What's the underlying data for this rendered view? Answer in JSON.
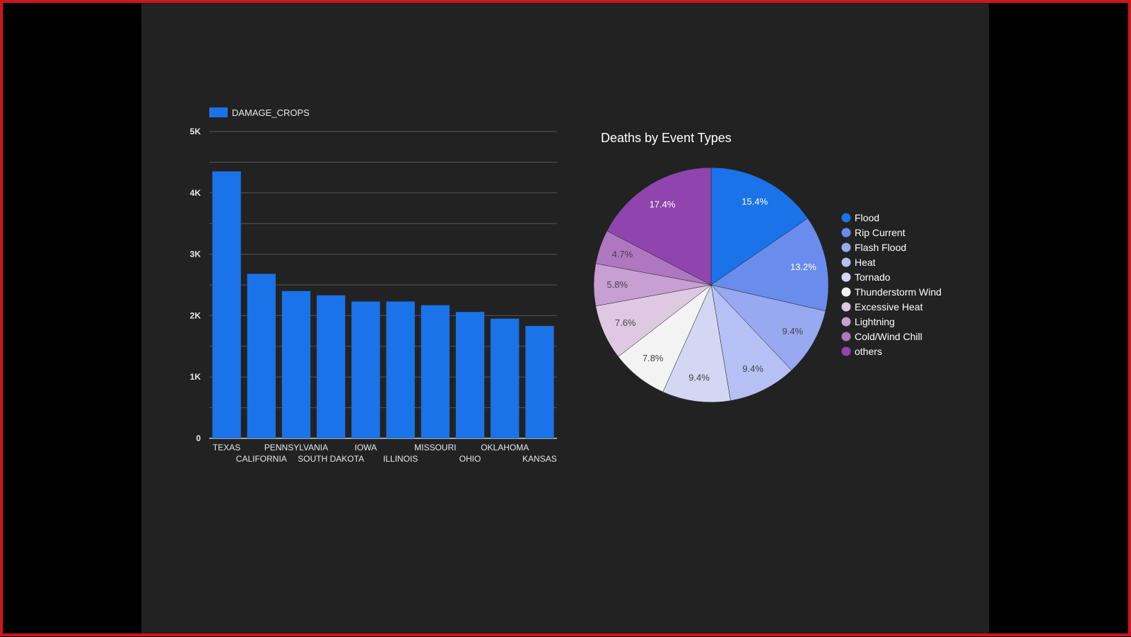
{
  "colors": {
    "frame_border": "#d0141e",
    "canvas_bg": "#222222",
    "bar": "#1a73e8",
    "axis_text": "#e8e8e8",
    "grid": "#555555"
  },
  "chart_data": [
    {
      "type": "bar",
      "title": "",
      "legend": {
        "label": "DAMAGE_CROPS",
        "position": "top-left"
      },
      "categories": [
        "TEXAS",
        "CALIFORNIA",
        "PENNSYLVANIA",
        "SOUTH DAKOTA",
        "IOWA",
        "ILLINOIS",
        "MISSOURI",
        "OHIO",
        "OKLAHOMA",
        "KANSAS"
      ],
      "series": [
        {
          "name": "DAMAGE_CROPS",
          "values": [
            4350,
            2680,
            2400,
            2330,
            2230,
            2230,
            2170,
            2060,
            1950,
            1830
          ],
          "color": "#1a73e8"
        }
      ],
      "ylim": [
        0,
        5000
      ],
      "yticks": [
        0,
        1000,
        2000,
        3000,
        4000,
        5000
      ],
      "ytick_labels": [
        "0",
        "1K",
        "2K",
        "3K",
        "4K",
        "5K"
      ],
      "grid": true,
      "xlabel": "",
      "ylabel": ""
    },
    {
      "type": "pie",
      "title": "Deaths by Event Types",
      "legend_position": "right",
      "slices": [
        {
          "label": "Flood",
          "value": 15.4,
          "display": "15.4%",
          "color": "#1a73e8"
        },
        {
          "label": "Rip Current",
          "value": 13.2,
          "display": "13.2%",
          "color": "#6a8ced"
        },
        {
          "label": "Flash Flood",
          "value": 9.4,
          "display": "9.4%",
          "color": "#98a8f1"
        },
        {
          "label": "Heat",
          "value": 9.4,
          "display": "9.4%",
          "color": "#b6c0f4"
        },
        {
          "label": "Tornado",
          "value": 9.4,
          "display": "9.4%",
          "color": "#d3d7f4"
        },
        {
          "label": "Thunderstorm Wind",
          "value": 7.8,
          "display": "7.8%",
          "color": "#f3f3f3"
        },
        {
          "label": "Excessive Heat",
          "value": 7.6,
          "display": "7.6%",
          "color": "#dfc8e2"
        },
        {
          "label": "Lightning",
          "value": 5.8,
          "display": "5.8%",
          "color": "#c79fd2"
        },
        {
          "label": "Cold/Wind Chill",
          "value": 4.7,
          "display": "4.7%",
          "color": "#ae77c0"
        },
        {
          "label": "others",
          "value": 17.4,
          "display": "17.4%",
          "color": "#8f45ad"
        }
      ]
    }
  ]
}
